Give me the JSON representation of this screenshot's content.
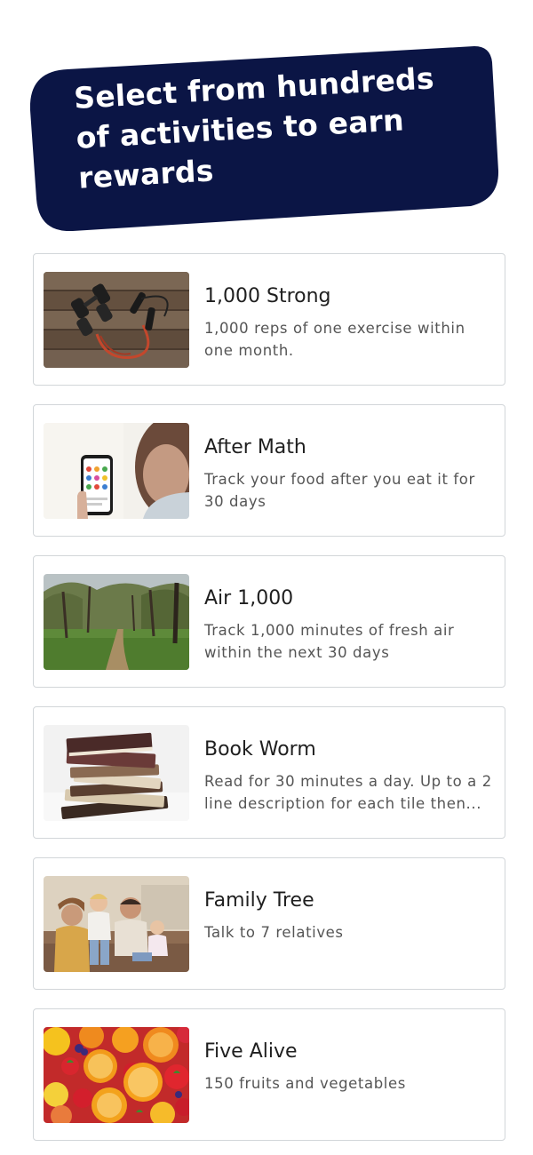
{
  "header": {
    "title": "Select from hundreds of activities to earn rewards",
    "background_color": "#0b1545"
  },
  "activities": [
    {
      "title": "1,000 Strong",
      "description": "1,000 reps of one exercise within one month.",
      "image": "dumbbells-resistance-band-photo"
    },
    {
      "title": "After Math",
      "description": "Track your food after you eat it for 30 days",
      "image": "phone-in-hand-photo"
    },
    {
      "title": "Air 1,000",
      "description": "Track 1,000 minutes of fresh air within the next 30 days",
      "image": "forest-path-photo"
    },
    {
      "title": "Book Worm",
      "description": "Read for 30 minutes a day. Up to a 2 line description for each tile then...",
      "image": "stack-of-books-photo"
    },
    {
      "title": "Family Tree",
      "description": "Talk to 7 relatives",
      "image": "family-on-couch-photo"
    },
    {
      "title": "Five Alive",
      "description": "150 fruits and vegetables",
      "image": "fruits-photo"
    }
  ]
}
